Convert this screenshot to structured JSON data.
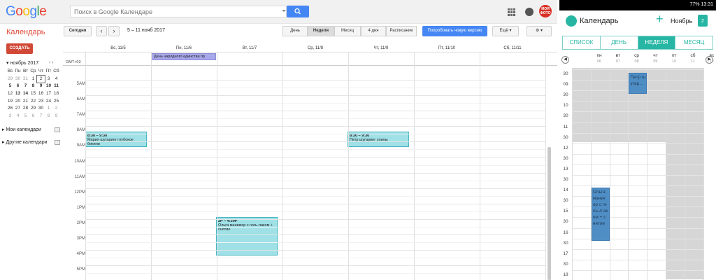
{
  "desktop": {
    "logo": "Google",
    "logo_colors": [
      "#4285f4",
      "#ea4335",
      "#fbbc05",
      "#4285f4",
      "#34a853",
      "#ea4335"
    ],
    "search": {
      "placeholder": "Поиск в Google Календаре"
    },
    "avatar_text": "МОЯ ФОТО",
    "app_title": "Календарь",
    "toolbar": {
      "today": "Сегодня",
      "prev": "‹",
      "next": "›",
      "date_range": "5 – 11 нояб 2017",
      "views": [
        "День",
        "Неделя",
        "Месяц",
        "4 дня",
        "Расписание"
      ],
      "active_view": "Неделя",
      "try_new": "Попробовать новую версию",
      "more": "Ещё ▾",
      "gear": "⚙ ▾"
    },
    "create": "СОЗДАТЬ",
    "mini": {
      "title": "ноябрь 2017",
      "nav": "‹  ›",
      "weekdays": [
        "Вс",
        "Пн",
        "Вт",
        "Ср",
        "Чт",
        "Пт",
        "Сб"
      ],
      "weeks": [
        [
          "29",
          "30",
          "31",
          "1",
          "2",
          "3",
          "4"
        ],
        [
          "5",
          "6",
          "7",
          "8",
          "9",
          "10",
          "11"
        ],
        [
          "12",
          "13",
          "14",
          "15",
          "16",
          "17",
          "18"
        ],
        [
          "19",
          "20",
          "21",
          "22",
          "23",
          "24",
          "25"
        ],
        [
          "26",
          "27",
          "28",
          "29",
          "30",
          "1",
          "2"
        ],
        [
          "3",
          "4",
          "5",
          "6",
          "7",
          "8",
          "9"
        ]
      ]
    },
    "my_calendars": "Мои календари",
    "other_calendars": "Другие календари",
    "gmt": "GMT+03",
    "days": [
      "Вс, 11/5",
      "Пн, 11/6",
      "Вт, 11/7",
      "Ср, 11/8",
      "Чт, 11/9",
      "Пт, 11/10",
      "Сб, 11/11"
    ],
    "hours": [
      "5AM",
      "6AM",
      "7AM",
      "8AM",
      "9AM",
      "10AM",
      "11AM",
      "12PM",
      "1PM",
      "2PM",
      "3PM",
      "4PM",
      "5PM"
    ],
    "allday_event": "День народного единства пр",
    "events": [
      {
        "time": "8:30 – 9:30",
        "title": "Мария шугаринг глубокое бикини"
      },
      {
        "time": "8:30 – 9:30",
        "title": "Петр шугаринг спины"
      },
      {
        "time": "2P – 4:30P",
        "title": "Ольга маникюр с гель-лаком + снятие"
      }
    ]
  },
  "phone": {
    "status_right": "77% 13:31",
    "title": "Календарь",
    "plus": "+",
    "month": "Ноябрь",
    "cal_icon_day": "2",
    "tabs": [
      "СПИСОК",
      "ДЕНЬ",
      "НЕДЕЛЯ",
      "МЕСЯЦ"
    ],
    "active_tab": "НЕДЕЛЯ",
    "weekdays": [
      {
        "d": "пн",
        "n": "06"
      },
      {
        "d": "вт",
        "n": "07"
      },
      {
        "d": "ср",
        "n": "08"
      },
      {
        "d": "чт",
        "n": "09"
      },
      {
        "d": "пт",
        "n": "10"
      },
      {
        "d": "сб",
        "n": "11"
      },
      {
        "d": "вс",
        "n": "12"
      }
    ],
    "hour_labels": [
      "30",
      "09",
      "30",
      "10",
      "30",
      "11",
      "30",
      "12",
      "30",
      "13",
      "30",
      "14",
      "30",
      "15",
      "30",
      "16",
      "30",
      "17",
      "30",
      "18"
    ],
    "events": [
      {
        "title": "Петр шугар..."
      },
      {
        "title": "Ольга маник ор с гель-л аком + снятие"
      }
    ],
    "colors": {
      "accent": "#26b6a3",
      "event": "#4f8ec5"
    }
  }
}
